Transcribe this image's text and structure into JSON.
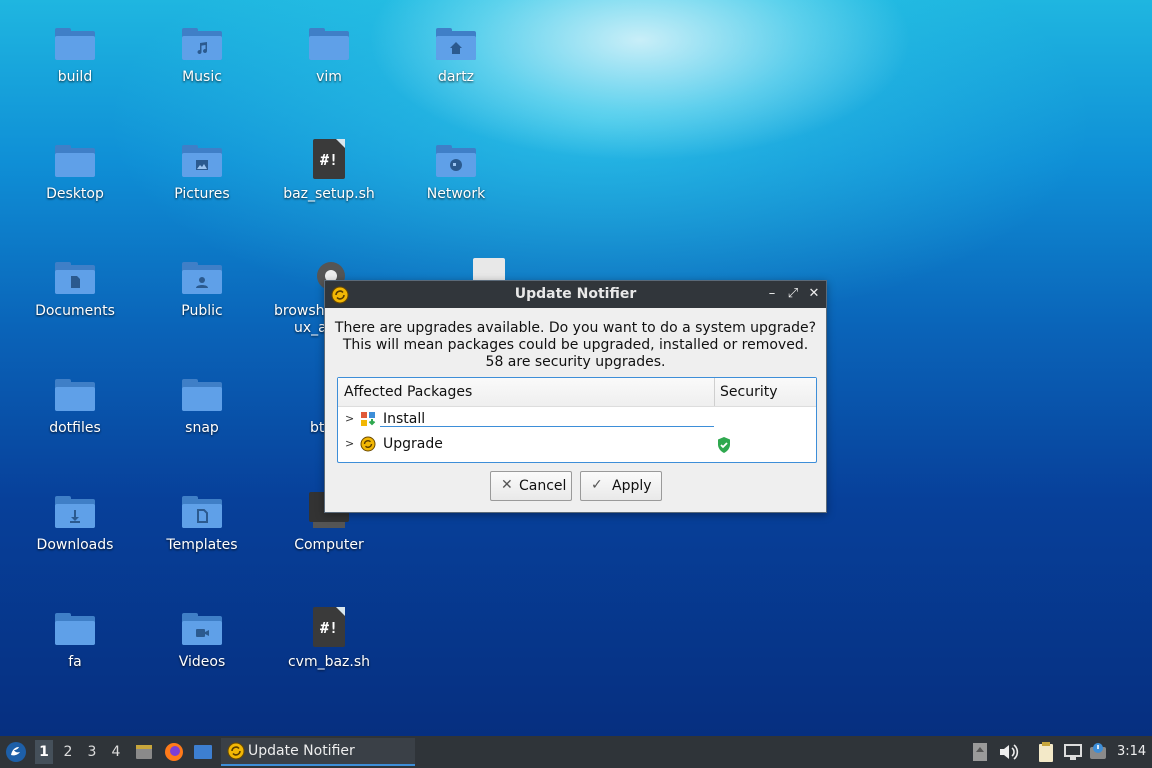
{
  "desktop": {
    "icons": {
      "build": "build",
      "music": "Music",
      "vim": "vim",
      "dartz": "dartz",
      "desktop": "Desktop",
      "pictures": "Pictures",
      "baz_setup": "baz_setup.sh",
      "network": "Network",
      "documents": "Documents",
      "public": "Public",
      "browsh_line1": "browsh_",
      "browsh_line2": "ux_a",
      "dotfiles": "dotfiles",
      "snap": "snap",
      "bt": "bt",
      "downloads": "Downloads",
      "templates": "Templates",
      "computer": "Computer",
      "fa": "fa",
      "videos": "Videos",
      "cvm_baz": "cvm_baz.sh"
    }
  },
  "dialog": {
    "title": "Update Notifier",
    "message_line1": "There are upgrades available. Do you want to do a system upgrade?",
    "message_line2": "This will mean packages could be upgraded, installed or removed.",
    "message_line3": "58 are security upgrades.",
    "columns": {
      "packages": "Affected Packages",
      "security": "Security"
    },
    "rows": {
      "install": "Install",
      "upgrade": "Upgrade"
    },
    "buttons": {
      "cancel": "Cancel",
      "apply": "Apply"
    }
  },
  "taskbar": {
    "workspaces": [
      "1",
      "2",
      "3",
      "4"
    ],
    "task_label": "Update Notifier",
    "clock": "3:14"
  },
  "colors": {
    "accent": "#3d8ed8",
    "titlebar": "#31363b",
    "taskbar": "#2f3439",
    "security_shield": "#2fa84f"
  }
}
